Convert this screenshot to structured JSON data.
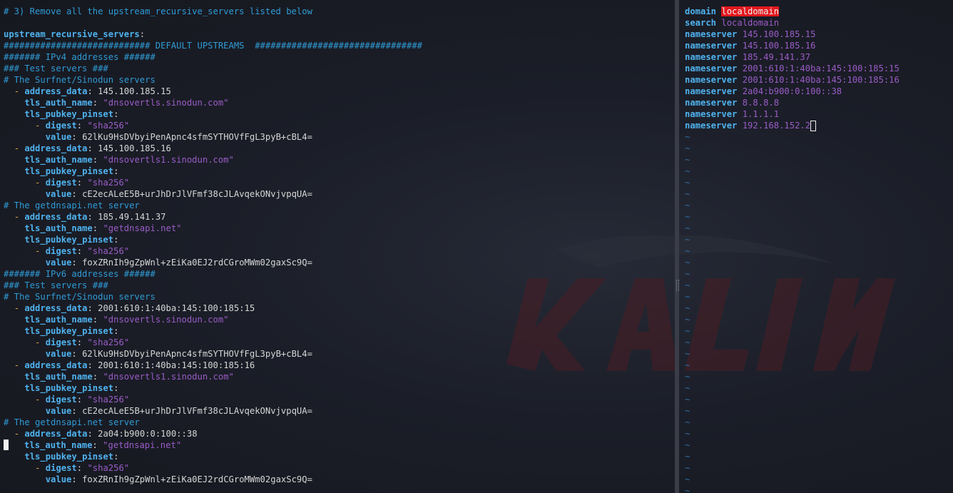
{
  "left_editor": {
    "lines": [
      {
        "type": "comment",
        "text": "# 3) Remove all the upstream_recursive_servers listed below"
      },
      {
        "type": "blank",
        "text": ""
      },
      {
        "type": "toplevel",
        "key": "upstream_recursive_servers"
      },
      {
        "type": "comment",
        "text": "############################ DEFAULT UPSTREAMS  ################################"
      },
      {
        "type": "comment",
        "text": "####### IPv4 addresses ######"
      },
      {
        "type": "comment",
        "text": "### Test servers ###"
      },
      {
        "type": "comment",
        "text": "# The Surfnet/Sinodun servers"
      },
      {
        "type": "item",
        "key": "address_data",
        "value": "145.100.185.15"
      },
      {
        "type": "field",
        "key": "tls_auth_name",
        "value": "\"dnsovertls.sinodun.com\""
      },
      {
        "type": "fieldkey",
        "key": "tls_pubkey_pinset"
      },
      {
        "type": "subitem",
        "key": "digest",
        "value": "\"sha256\""
      },
      {
        "type": "subfield",
        "key": "value",
        "value": "62lKu9HsDVbyiPenApnc4sfmSYTHOVfFgL3pyB+cBL4="
      },
      {
        "type": "item",
        "key": "address_data",
        "value": "145.100.185.16"
      },
      {
        "type": "field",
        "key": "tls_auth_name",
        "value": "\"dnsovertls1.sinodun.com\""
      },
      {
        "type": "fieldkey",
        "key": "tls_pubkey_pinset"
      },
      {
        "type": "subitem",
        "key": "digest",
        "value": "\"sha256\""
      },
      {
        "type": "subfield",
        "key": "value",
        "value": "cE2ecALeE5B+urJhDrJlVFmf38cJLAvqekONvjvpqUA="
      },
      {
        "type": "comment",
        "text": "# The getdnsapi.net server"
      },
      {
        "type": "item",
        "key": "address_data",
        "value": "185.49.141.37"
      },
      {
        "type": "field",
        "key": "tls_auth_name",
        "value": "\"getdnsapi.net\""
      },
      {
        "type": "fieldkey",
        "key": "tls_pubkey_pinset"
      },
      {
        "type": "subitem",
        "key": "digest",
        "value": "\"sha256\""
      },
      {
        "type": "subfield",
        "key": "value",
        "value": "foxZRnIh9gZpWnl+zEiKa0EJ2rdCGroMWm02gaxSc9Q="
      },
      {
        "type": "comment",
        "text": "####### IPv6 addresses ######"
      },
      {
        "type": "comment",
        "text": "### Test servers ###"
      },
      {
        "type": "comment",
        "text": "# The Surfnet/Sinodun servers"
      },
      {
        "type": "item",
        "key": "address_data",
        "value": "2001:610:1:40ba:145:100:185:15"
      },
      {
        "type": "field",
        "key": "tls_auth_name",
        "value": "\"dnsovertls.sinodun.com\""
      },
      {
        "type": "fieldkey",
        "key": "tls_pubkey_pinset"
      },
      {
        "type": "subitem",
        "key": "digest",
        "value": "\"sha256\""
      },
      {
        "type": "subfield",
        "key": "value",
        "value": "62lKu9HsDVbyiPenApnc4sfmSYTHOVfFgL3pyB+cBL4="
      },
      {
        "type": "item",
        "key": "address_data",
        "value": "2001:610:1:40ba:145:100:185:16"
      },
      {
        "type": "field",
        "key": "tls_auth_name",
        "value": "\"dnsovertls1.sinodun.com\""
      },
      {
        "type": "fieldkey",
        "key": "tls_pubkey_pinset"
      },
      {
        "type": "subitem",
        "key": "digest",
        "value": "\"sha256\""
      },
      {
        "type": "subfield",
        "key": "value",
        "value": "cE2ecALeE5B+urJhDrJlVFmf38cJLAvqekONvjvpqUA="
      },
      {
        "type": "comment",
        "text": "# The getdnsapi.net server"
      },
      {
        "type": "item",
        "key": "address_data",
        "value": "2a04:b900:0:100::38"
      },
      {
        "type": "field",
        "key": "tls_auth_name",
        "value": "\"getdnsapi.net\"",
        "cursor": true
      },
      {
        "type": "fieldkey",
        "key": "tls_pubkey_pinset"
      },
      {
        "type": "subitem",
        "key": "digest",
        "value": "\"sha256\""
      },
      {
        "type": "subfield",
        "key": "value",
        "value": "foxZRnIh9gZpWnl+zEiKa0EJ2rdCGroMWm02gaxSc9Q="
      }
    ]
  },
  "right_editor": {
    "lines": [
      {
        "keyword": "domain",
        "value": "localdomain",
        "highlight": true
      },
      {
        "keyword": "search",
        "value": "localdomain"
      },
      {
        "keyword": "nameserver",
        "value": "145.100.185.15"
      },
      {
        "keyword": "nameserver",
        "value": "145.100.185.16"
      },
      {
        "keyword": "nameserver",
        "value": "185.49.141.37"
      },
      {
        "keyword": "nameserver",
        "value": "2001:610:1:40ba:145:100:185:15"
      },
      {
        "keyword": "nameserver",
        "value": "2001:610:1:40ba:145:100:185:16"
      },
      {
        "keyword": "nameserver",
        "value": "2a04:b900:0:100::38"
      },
      {
        "keyword": "nameserver",
        "value": "8.8.8.8"
      },
      {
        "keyword": "nameserver",
        "value": "1.1.1.1"
      },
      {
        "keyword": "nameserver",
        "value": "192.168.152.2",
        "cursor": true
      }
    ],
    "tilde_marker": "~",
    "tilde_count": 32
  },
  "colors": {
    "comment": "#2f9bd6",
    "key": "#4fb2ee",
    "string": "#9a5cc7",
    "dash": "#e8a33c",
    "highlight": "#e3171d",
    "tilde": "#2f6fa8"
  }
}
